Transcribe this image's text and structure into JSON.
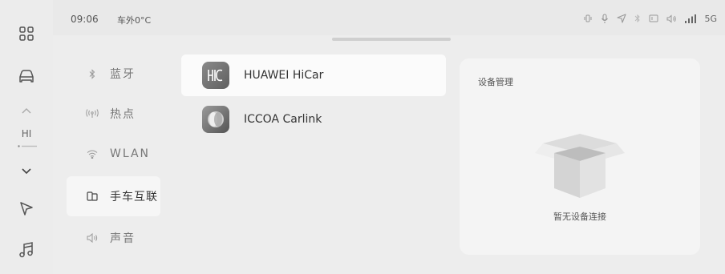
{
  "status_bar": {
    "time": "09:06",
    "outside_temp": "车外0°C",
    "network": "5G"
  },
  "dock": {
    "items": [
      {
        "icon": "apps-grid-icon"
      },
      {
        "icon": "car-icon"
      },
      {
        "icon": "chevron-up-icon"
      },
      {
        "icon": "chevron-down-icon"
      },
      {
        "icon": "navigation-icon"
      },
      {
        "icon": "music-icon"
      }
    ],
    "fan_label": "HI"
  },
  "settings_menu": {
    "items": [
      {
        "icon": "bluetooth-icon",
        "label": "蓝牙",
        "active": false
      },
      {
        "icon": "hotspot-icon",
        "label": "热点",
        "active": false
      },
      {
        "icon": "wifi-icon",
        "label": "WLAN",
        "active": false
      },
      {
        "icon": "phone-car-link-icon",
        "label": "手车互联",
        "active": true
      },
      {
        "icon": "speaker-icon",
        "label": "声音",
        "active": false
      }
    ]
  },
  "protocols": {
    "items": [
      {
        "name": "HUAWEI HiCar",
        "icon": "hicar-logo-icon",
        "selected": true
      },
      {
        "name": "ICCOA Carlink",
        "icon": "carlink-logo-icon",
        "selected": false
      }
    ]
  },
  "device_card": {
    "title": "设备管理",
    "empty_message": "暂无设备连接"
  },
  "colors": {
    "background": "#e9e9e9",
    "panel": "#ededed",
    "selected_row": "#fbfbfb",
    "card": "#f4f4f4",
    "text_primary": "#333333",
    "text_secondary": "#777777"
  }
}
